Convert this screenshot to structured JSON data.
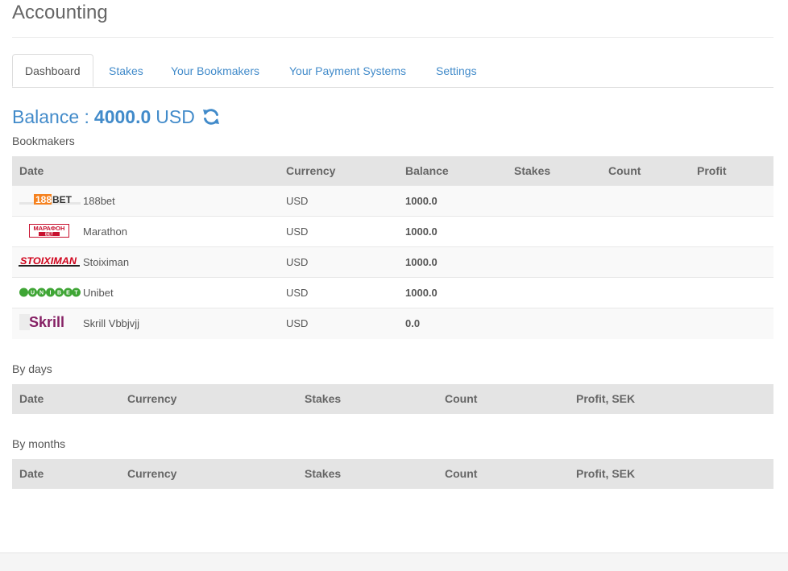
{
  "page": {
    "title": "Accounting"
  },
  "tabs": [
    {
      "label": "Dashboard",
      "active": true
    },
    {
      "label": "Stakes",
      "active": false
    },
    {
      "label": "Your Bookmakers",
      "active": false
    },
    {
      "label": "Your Payment Systems",
      "active": false
    },
    {
      "label": "Settings",
      "active": false
    }
  ],
  "balance": {
    "label": "Balance :",
    "amount": "4000.0",
    "currency": "USD",
    "refresh_icon": "refresh-icon"
  },
  "bookmakers": {
    "label": "Bookmakers",
    "headers": [
      "Date",
      "Currency",
      "Balance",
      "Stakes",
      "Count",
      "Profit"
    ],
    "rows": [
      {
        "logo": "188BET",
        "name": "188bet",
        "currency": "USD",
        "balance": "1000.0"
      },
      {
        "logo": "МАРАФОН",
        "logo_sub": "BET",
        "name": "Marathon",
        "currency": "USD",
        "balance": "1000.0"
      },
      {
        "logo": "STOIXIMAN",
        "name": "Stoiximan",
        "currency": "USD",
        "balance": "1000.0"
      },
      {
        "logo": "UNIBET",
        "name": "Unibet",
        "currency": "USD",
        "balance": "1000.0"
      },
      {
        "logo": "Skrill",
        "name": "Skrill Vbbjvjj",
        "currency": "USD",
        "balance": "0.0"
      }
    ]
  },
  "by_days": {
    "label": "By days",
    "headers": [
      "Date",
      "Currency",
      "Stakes",
      "Count",
      "Profit, SEK"
    ]
  },
  "by_months": {
    "label": "By months",
    "headers": [
      "Date",
      "Currency",
      "Stakes",
      "Count",
      "Profit, SEK"
    ]
  },
  "colors": {
    "accent": "#428bca",
    "header_bg": "#e4e4e4",
    "skrill": "#862165",
    "unibet": "#3fa535",
    "bet188": "#f58220",
    "stoiximan": "#d0021b",
    "marathon": "#c8102e"
  }
}
